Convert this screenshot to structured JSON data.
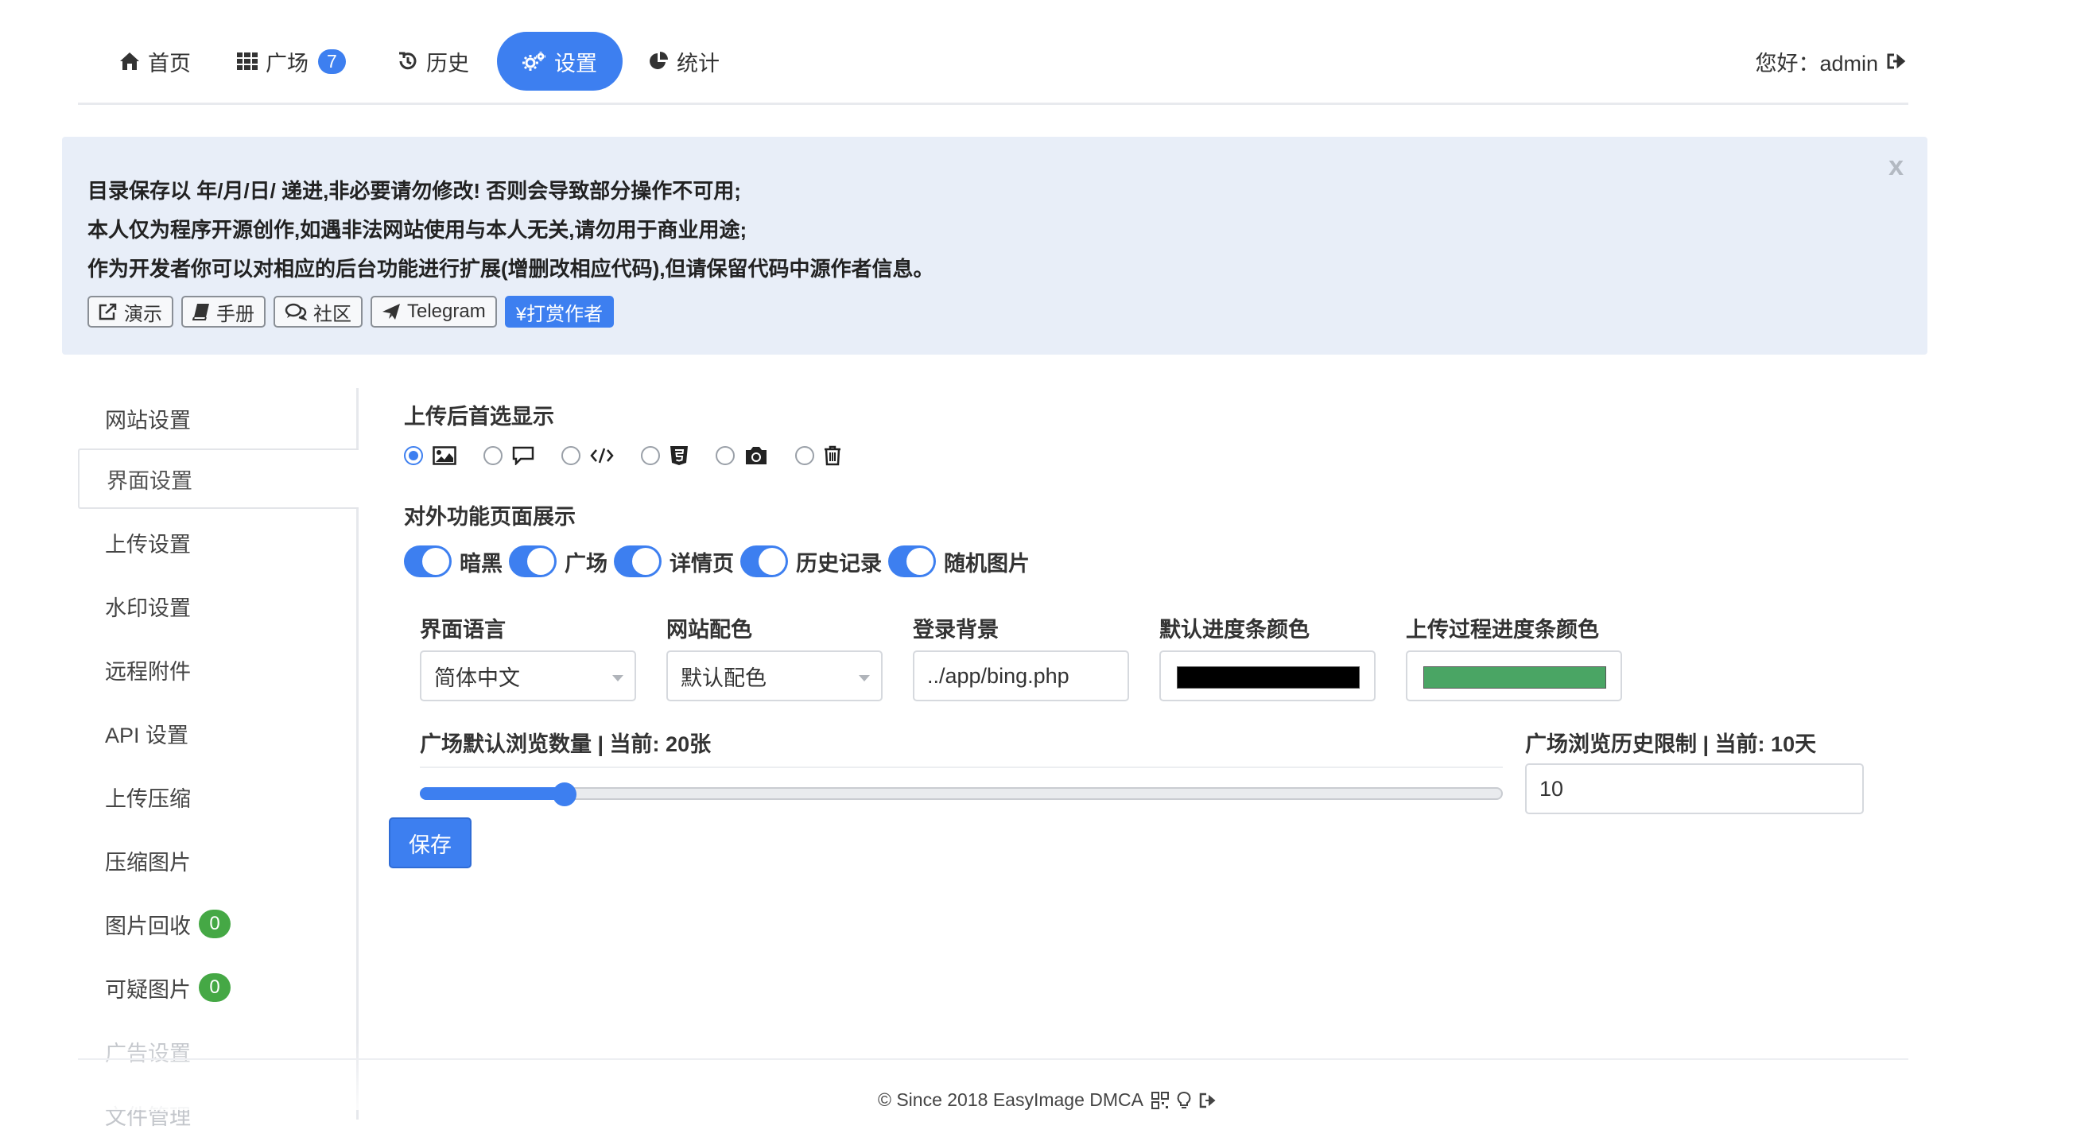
{
  "nav": {
    "items": [
      {
        "label": "首页",
        "icon": "home-icon"
      },
      {
        "label": "广场",
        "icon": "grid-icon",
        "badge": "7"
      },
      {
        "label": "历史",
        "icon": "history-icon"
      },
      {
        "label": "设置",
        "icon": "gears-icon",
        "active": true
      },
      {
        "label": "统计",
        "icon": "pie-chart-icon"
      }
    ],
    "greeting": "您好：admin",
    "accent": "#3d7ff0"
  },
  "notice": {
    "lines": [
      "目录保存以 年/月/日/ 递进,非必要请勿修改! 否则会导致部分操作不可用;",
      "本人仅为程序开源创作,如遇非法网站使用与本人无关,请勿用于商业用途;",
      "作为开发者你可以对相应的后台功能进行扩展(增删改相应代码),但请保留代码中源作者信息。"
    ],
    "close": "x",
    "buttons": [
      {
        "label": "演示",
        "icon": "external-link-icon"
      },
      {
        "label": "手册",
        "icon": "book-icon"
      },
      {
        "label": "社区",
        "icon": "comments-icon"
      },
      {
        "label": "Telegram",
        "icon": "plane-icon"
      },
      {
        "label": "¥打赏作者",
        "icon": "yen-icon"
      }
    ]
  },
  "sidebar": {
    "items": [
      {
        "label": "网站设置"
      },
      {
        "label": "界面设置",
        "active": true
      },
      {
        "label": "上传设置"
      },
      {
        "label": "水印设置"
      },
      {
        "label": "远程附件"
      },
      {
        "label": "API 设置"
      },
      {
        "label": "上传压缩"
      },
      {
        "label": "压缩图片"
      },
      {
        "label": "图片回收",
        "badge": "0"
      },
      {
        "label": "可疑图片",
        "badge": "0"
      },
      {
        "label": "广告设置"
      },
      {
        "label": "文件管理"
      }
    ]
  },
  "form": {
    "upload_display_label": "上传后首选显示",
    "upload_display_options": [
      {
        "icon": "image-icon",
        "selected": true
      },
      {
        "icon": "comment-icon"
      },
      {
        "icon": "code-icon"
      },
      {
        "icon": "html5-icon"
      },
      {
        "icon": "camera-icon"
      },
      {
        "icon": "trash-icon"
      }
    ],
    "features_label": "对外功能页面展示",
    "toggles": [
      {
        "label": "暗黑",
        "on": true
      },
      {
        "label": "广场",
        "on": true
      },
      {
        "label": "详情页",
        "on": true
      },
      {
        "label": "历史记录",
        "on": true
      },
      {
        "label": "随机图片",
        "on": true
      }
    ],
    "language": {
      "label": "界面语言",
      "value": "简体中文"
    },
    "theme_color": {
      "label": "网站配色",
      "value": "默认配色"
    },
    "login_bg": {
      "label": "登录背景",
      "value": "../app/bing.php"
    },
    "progress_color": {
      "label": "默认进度条颜色",
      "color": "#000000"
    },
    "upload_progress_color": {
      "label": "上传过程进度条颜色",
      "color": "#4aa564"
    },
    "square_count": {
      "label": "广场默认浏览数量 | 当前: 20张",
      "value": 20,
      "max": 150
    },
    "history_limit": {
      "label": "广场浏览历史限制 | 当前: 10天",
      "value": "10"
    },
    "save_label": "保存"
  },
  "footer": {
    "text": "© Since 2018 EasyImage DMCA"
  }
}
